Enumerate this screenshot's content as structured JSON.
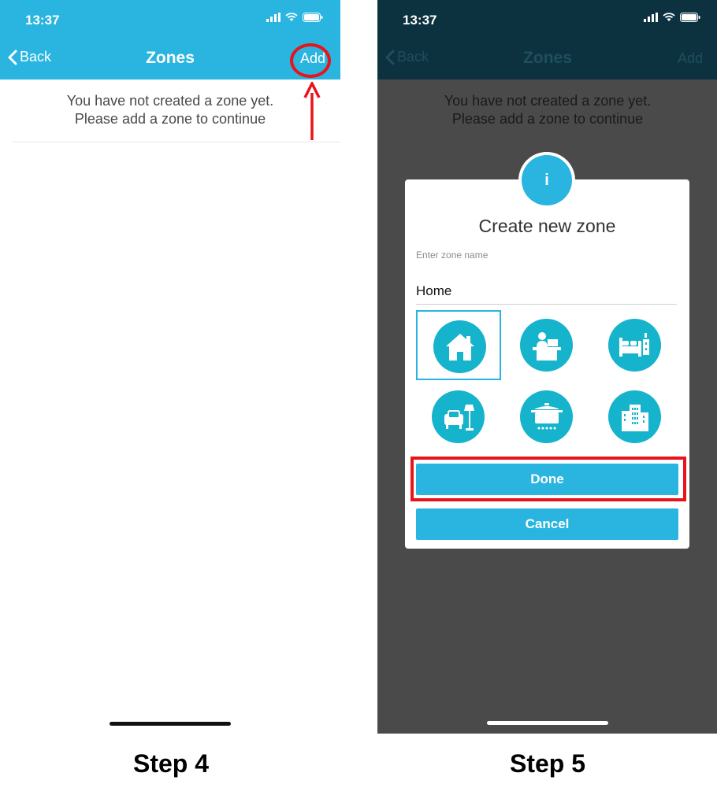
{
  "status": {
    "time": "13:37"
  },
  "nav": {
    "back_label": "Back",
    "title": "Zones",
    "add_label": "Add"
  },
  "message": {
    "line1": "You have not created a zone yet.",
    "line2": "Please add a zone to continue"
  },
  "dialog": {
    "badge": "i",
    "title": "Create new zone",
    "input_label": "Enter zone name",
    "input_value": "Home",
    "icons": [
      "home-icon",
      "office-icon",
      "bedroom-icon",
      "living-room-icon",
      "kitchen-icon",
      "building-icon"
    ],
    "selected_icon": "home-icon",
    "done_label": "Done",
    "cancel_label": "Cancel"
  },
  "steps": {
    "left": "Step 4",
    "right": "Step 5"
  },
  "colors": {
    "accent": "#29b5e0",
    "icon_teal": "#16b3cd",
    "highlight_red": "#e8141b",
    "overlay_dark": "#4a4a4a"
  }
}
